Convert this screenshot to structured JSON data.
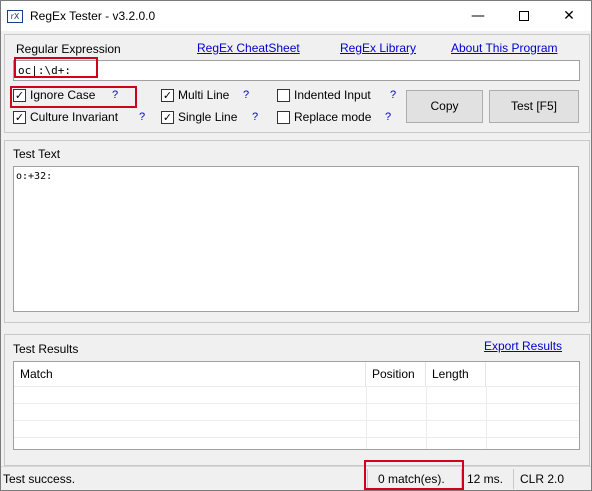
{
  "window": {
    "title": "RegEx Tester - v3.2.0.0",
    "icon_text": "rX",
    "controls": {
      "minimize": "—",
      "close": "✕"
    }
  },
  "regex_panel": {
    "label": "Regular Expression",
    "links": {
      "cheatsheet": "RegEx CheatSheet",
      "library": "RegEx Library",
      "about": "About This Program"
    },
    "expression": "oc|:\\d+:",
    "options": {
      "ignore_case": {
        "label": "Ignore Case",
        "checked": true
      },
      "multi_line": {
        "label": "Multi Line",
        "checked": true
      },
      "indented_input": {
        "label": "Indented Input",
        "checked": false
      },
      "culture_invariant": {
        "label": "Culture Invariant",
        "checked": true
      },
      "single_line": {
        "label": "Single Line",
        "checked": true
      },
      "replace_mode": {
        "label": "Replace mode",
        "checked": false
      }
    },
    "help_mark": "?",
    "buttons": {
      "copy": "Copy",
      "test": "Test [F5]"
    }
  },
  "test_text_panel": {
    "label": "Test Text",
    "content": "o:+32:"
  },
  "results_panel": {
    "label": "Test Results",
    "export_link": "Export Results",
    "columns": [
      "Match",
      "Position",
      "Length",
      ""
    ],
    "rows": []
  },
  "status_bar": {
    "message": "Test success.",
    "matches": "0 match(es).",
    "time": "12 ms.",
    "clr": "CLR 2.0"
  },
  "colors": {
    "highlight": "#d0021b",
    "link": "#0000cc"
  }
}
